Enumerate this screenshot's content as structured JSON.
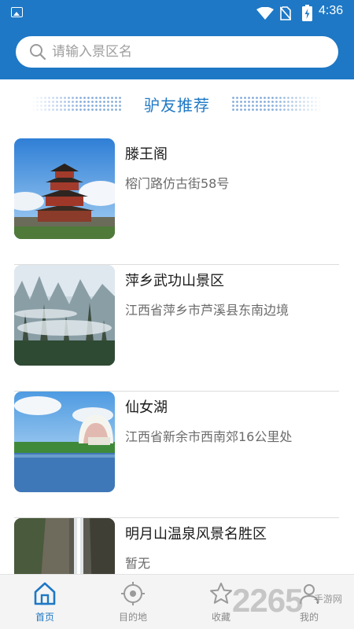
{
  "status_bar": {
    "time": "4:36",
    "icons": [
      "image-icon",
      "wifi-icon",
      "no-sim-icon",
      "battery-charging-icon"
    ]
  },
  "search": {
    "placeholder": "请输入景区名",
    "value": ""
  },
  "section": {
    "title": "驴友推荐"
  },
  "spots": [
    {
      "name": "滕王阁",
      "address": "榕门路仿古街58号"
    },
    {
      "name": "萍乡武功山景区",
      "address": "江西省萍乡市芦溪县东南边境"
    },
    {
      "name": "仙女湖",
      "address": "江西省新余市西南郊16公里处"
    },
    {
      "name": "明月山温泉风景名胜区",
      "address": "暂无"
    }
  ],
  "tabs": [
    {
      "label": "首页",
      "icon": "home-icon",
      "active": true
    },
    {
      "label": "目的地",
      "icon": "target-icon",
      "active": false
    },
    {
      "label": "收藏",
      "icon": "star-icon",
      "active": false
    },
    {
      "label": "我的",
      "icon": "person-icon",
      "active": false
    }
  ],
  "watermark": {
    "number": "2265",
    "suffix": ".",
    "text": "手游网"
  },
  "colors": {
    "brand_blue": "#1e78c5",
    "tab_inactive": "#8a8a8a"
  }
}
